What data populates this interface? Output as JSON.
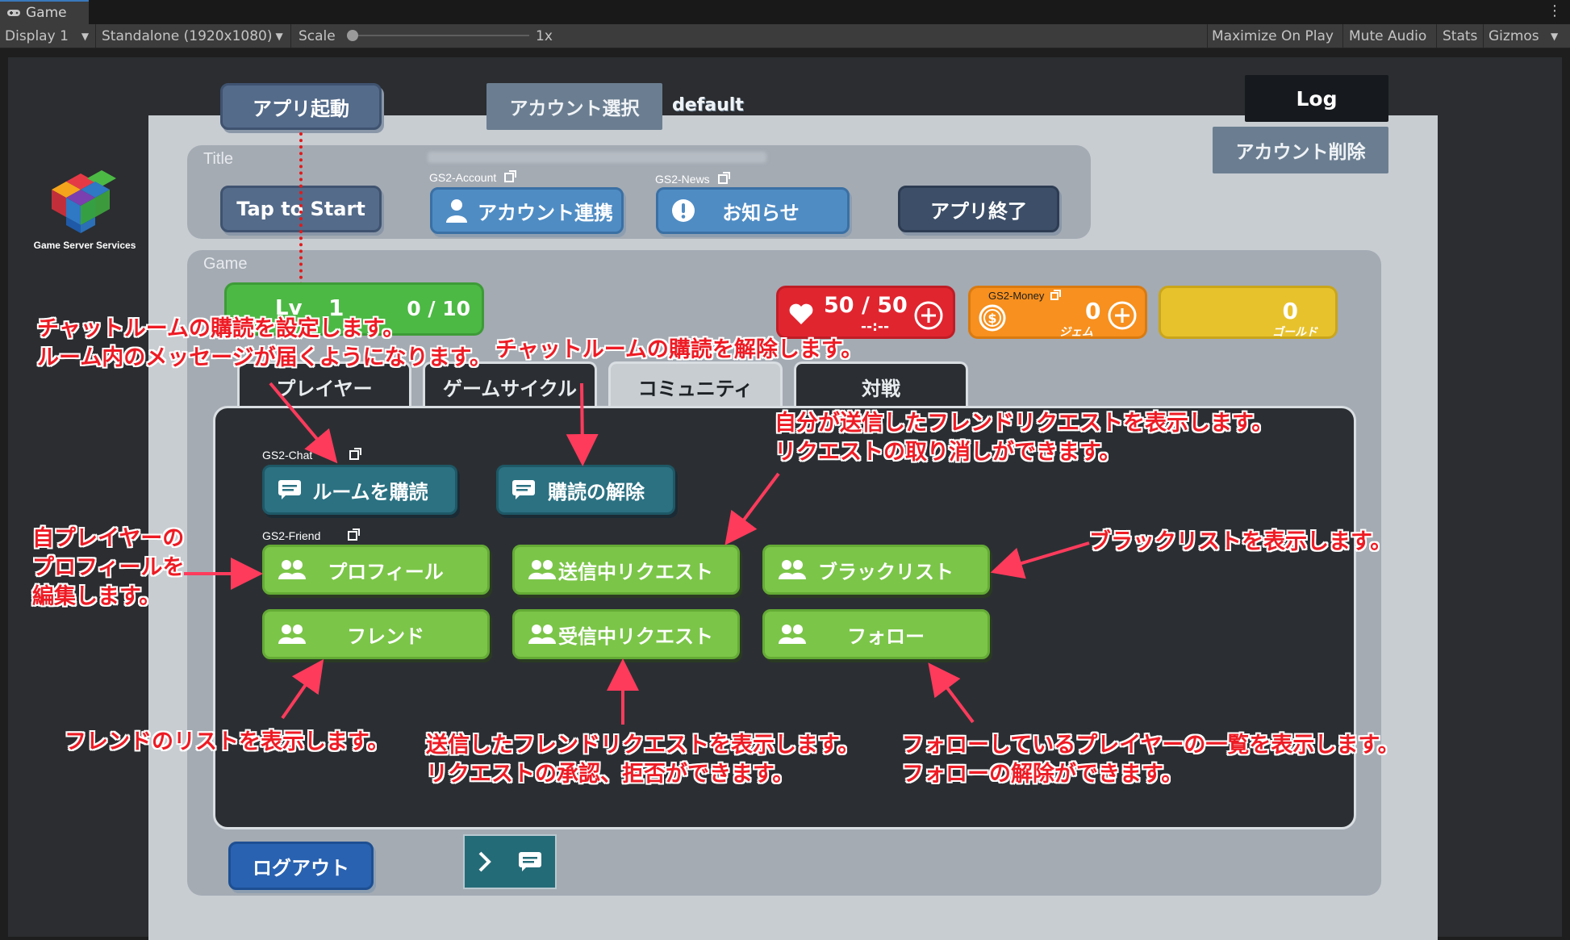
{
  "editor": {
    "tab_title": "Game",
    "display": "Display 1",
    "resolution": "Standalone (1920x1080)",
    "scale_label": "Scale",
    "scale_value": "1x",
    "maximize": "Maximize On Play",
    "mute": "Mute Audio",
    "stats": "Stats",
    "gizmos": "Gizmos"
  },
  "logo": {
    "text": "Game Server Services"
  },
  "top": {
    "app_start": "アプリ起動",
    "account_select": "アカウント選択",
    "account_name": "default",
    "log": "Log",
    "delete_account": "アカウント削除"
  },
  "title_panel": {
    "label": "Title",
    "tap_to_start": "Tap to Start",
    "account_service": "GS2-Account",
    "account_link": "アカウント連携",
    "news_service": "GS2-News",
    "news": "お知らせ",
    "app_exit": "アプリ終了"
  },
  "game_panel": {
    "label": "Game",
    "level_prefix": "Lv",
    "level": "1",
    "exp": "0 / 10",
    "stamina": "50 / 50",
    "stamina_timer": "--:--",
    "money_service": "GS2-Money",
    "gem_value": "0",
    "gem_label": "ジェム",
    "gold_value": "0",
    "gold_label": "ゴールド",
    "tabs": [
      {
        "label": "プレイヤー"
      },
      {
        "label": "ゲームサイクル"
      },
      {
        "label": "コミュニティ"
      },
      {
        "label": "対戦"
      }
    ],
    "chat_service": "GS2-Chat",
    "subscribe_room": "ルームを購読",
    "unsubscribe": "購読の解除",
    "friend_service": "GS2-Friend",
    "profile": "プロフィール",
    "send_requests": "送信中リクエスト",
    "blacklist": "ブラックリスト",
    "friends": "フレンド",
    "receive_requests": "受信中リクエスト",
    "follow": "フォロー",
    "logout": "ログアウト"
  },
  "notes": {
    "subscribe_1": "チャットルームの購読を設定します。",
    "subscribe_2": "ルーム内のメッセージが届くようになります。",
    "unsubscribe": "チャットルームの購読を解除します。",
    "send_1": "自分が送信したフレンドリクエストを表示します。",
    "send_2": "リクエストの取り消しができます。",
    "blacklist": "ブラックリストを表示します。",
    "profile_1": "自プレイヤーの",
    "profile_2": "プロフィールを",
    "profile_3": "編集します。",
    "friends": "フレンドのリストを表示します。",
    "receive_1": "送信したフレンドリクエストを表示します。",
    "receive_2": "リクエストの承認、拒否ができます。",
    "follow_1": "フォローしているプレイヤーの一覧を表示します。",
    "follow_2": "フォローの解除ができます。"
  },
  "colors": {
    "accent_green": "#7bc548",
    "accent_red": "#e0252f",
    "accent_orange": "#f7901e",
    "accent_gold": "#e8c22c",
    "annotation_red": "#ee1b24"
  }
}
